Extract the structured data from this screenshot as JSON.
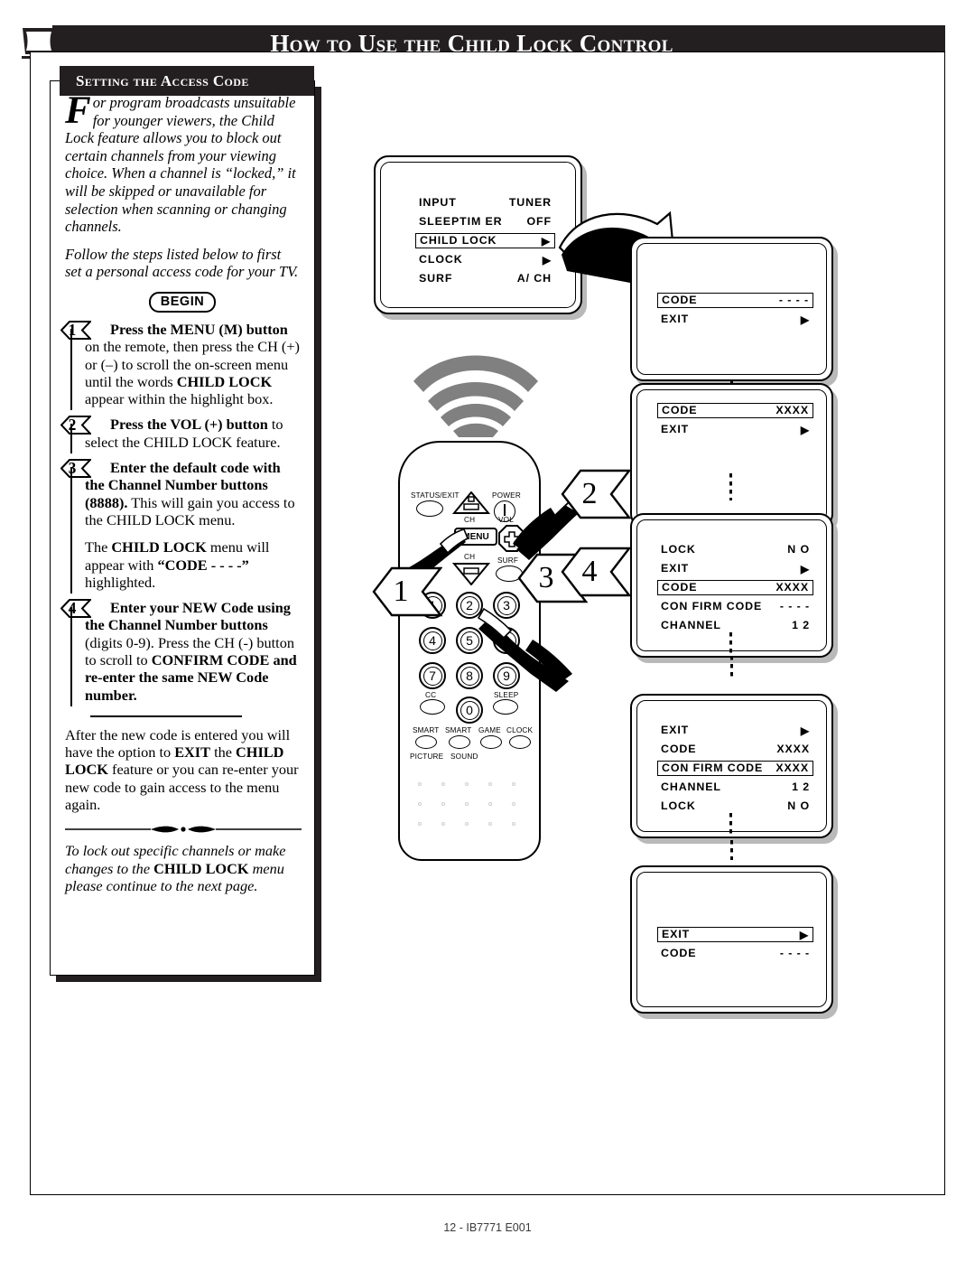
{
  "header": {
    "title": "How to Use the Child Lock Control",
    "tv_icon": "tv-set-icon"
  },
  "section": {
    "tab_label": "Setting the Access Code"
  },
  "intro": {
    "dropcap": "F",
    "paragraph1": "or program broadcasts unsuitable for younger viewers, the Child Lock feature allows you to block out certain channels from your viewing choice. When a channel is “locked,” it will be skipped or unavailable for selection when scanning or changing channels.",
    "paragraph2": "Follow the steps listed below to first set a personal access code for your TV."
  },
  "begin_badge": "BEGIN",
  "steps": [
    {
      "number": "1",
      "bold_lead": "Press the MENU (M) button",
      "rest": " on the remote, then press the CH (+) or (–) to scroll the on-screen menu until the words ",
      "bold_mid": "CHILD LOCK",
      "tail": " appear within the highlight box."
    },
    {
      "number": "2",
      "bold_lead": "Press the VOL (+) button",
      "rest": " to select the CHILD LOCK feature.",
      "bold_mid": "",
      "tail": ""
    },
    {
      "number": "3",
      "bold_lead": "Enter the default code with the Channel Number buttons (8888).",
      "rest": " This will gain you access to the CHILD LOCK menu.",
      "bold_mid": "",
      "tail": ""
    }
  ],
  "step3_note": {
    "lead": "The ",
    "bold1": "CHILD LOCK",
    "mid": " menu will appear with ",
    "bold2": "“CODE - - - -”",
    "tail": " highlighted."
  },
  "step4": {
    "number": "4",
    "bold_lead": "Enter your NEW Code using the Channel Number buttons",
    "rest": " (digits 0-9). Press the CH (-) button to scroll to ",
    "bold_mid": "CONFIRM CODE and re-enter the same NEW Code number."
  },
  "after_note": {
    "lead": "After the new code is entered you will have the option to ",
    "bold1": "EXIT",
    "mid": " the ",
    "bold2": "CHILD LOCK",
    "tail": " feature or you can re-enter your new code to gain access to the menu again."
  },
  "closing": {
    "lead": "To lock out specific channels or make changes to the ",
    "bold": "CHILD LOCK",
    "tail": " menu please continue to the next page."
  },
  "tv_menu": {
    "rows": [
      {
        "label": "INPUT",
        "value": "TUNER",
        "highlighted": false,
        "arrow": false
      },
      {
        "label": "SLEEPTIM ER",
        "value": "OFF",
        "highlighted": false,
        "arrow": false
      },
      {
        "label": "CHILD LOCK",
        "value": "",
        "highlighted": true,
        "arrow": true
      },
      {
        "label": "CLOCK",
        "value": "",
        "highlighted": false,
        "arrow": true
      },
      {
        "label": "SURF",
        "value": "A/ CH",
        "highlighted": false,
        "arrow": false
      }
    ]
  },
  "osd_screens": [
    {
      "id": "screen-1",
      "rows": [
        {
          "label": "CODE",
          "value": "- - - -",
          "highlighted": true,
          "arrow": false
        },
        {
          "label": "EXIT",
          "value": "",
          "highlighted": false,
          "arrow": true
        }
      ]
    },
    {
      "id": "screen-2",
      "rows": [
        {
          "label": "CODE",
          "value": "XXXX",
          "highlighted": true,
          "arrow": false
        },
        {
          "label": "EXIT",
          "value": "",
          "highlighted": false,
          "arrow": true
        }
      ]
    },
    {
      "id": "screen-3",
      "rows": [
        {
          "label": "LOCK",
          "value": "N O",
          "highlighted": false,
          "arrow": false
        },
        {
          "label": "EXIT",
          "value": "",
          "highlighted": false,
          "arrow": true
        },
        {
          "label": "CODE",
          "value": "XXXX",
          "highlighted": true,
          "arrow": false
        },
        {
          "label": "CON FIRM  CODE",
          "value": "- - - -",
          "highlighted": false,
          "arrow": false
        },
        {
          "label": "CHANNEL",
          "value": "1 2",
          "highlighted": false,
          "arrow": false
        }
      ]
    },
    {
      "id": "screen-4",
      "rows": [
        {
          "label": "EXIT",
          "value": "",
          "highlighted": false,
          "arrow": true
        },
        {
          "label": "CODE",
          "value": "XXXX",
          "highlighted": false,
          "arrow": false
        },
        {
          "label": "CON FIRM  CODE",
          "value": "XXXX",
          "highlighted": true,
          "arrow": false
        },
        {
          "label": "CHANNEL",
          "value": "1 2",
          "highlighted": false,
          "arrow": false
        },
        {
          "label": "LOCK",
          "value": "N O",
          "highlighted": false,
          "arrow": false
        }
      ]
    },
    {
      "id": "screen-5",
      "rows": [
        {
          "label": "EXIT",
          "value": "",
          "highlighted": true,
          "arrow": true
        },
        {
          "label": "CODE",
          "value": "- - - -",
          "highlighted": false,
          "arrow": false
        }
      ]
    }
  ],
  "remote": {
    "labels": {
      "status_exit": "STATUS/EXIT",
      "power": "POWER",
      "ch_up": "CH",
      "ch_down": "CH",
      "vol": "VOL",
      "menu": "MENU",
      "surf": "SURF",
      "cc": "CC",
      "sleep": "SLEEP",
      "smart1": "SMART",
      "smart2": "SMART",
      "game": "GAME",
      "clock": "CLOCK",
      "picture": "PICTURE",
      "sound": "SOUND"
    },
    "keypad": [
      "1",
      "2",
      "3",
      "4",
      "5",
      "6",
      "7",
      "8",
      "9",
      "0"
    ]
  },
  "callouts": [
    "1",
    "2",
    "3",
    "4"
  ],
  "footer": "12 - IB7771 E001",
  "colors": {
    "header_bar": "#231f20",
    "ink": "#000000",
    "paper": "#ffffff",
    "shadow": "#b9b9b9",
    "ir_wave": "#808080"
  }
}
